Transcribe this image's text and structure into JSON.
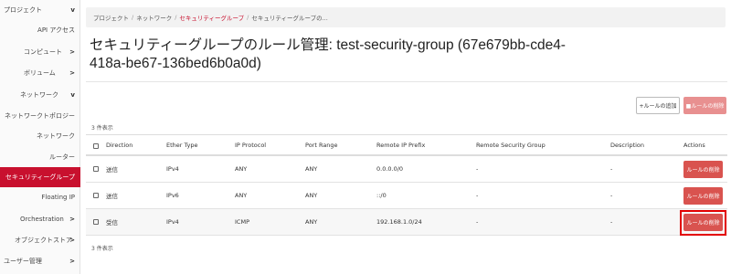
{
  "sidebar": {
    "items": [
      {
        "label": "プロジェクト",
        "chevron": "v"
      },
      {
        "label": "API アクセス",
        "chevron": ""
      },
      {
        "label": "コンピュート",
        "chevron": ">"
      },
      {
        "label": "ボリューム",
        "chevron": ">"
      },
      {
        "label": "ネットワーク",
        "chevron": "v"
      },
      {
        "label": "ネットワークトポロジー",
        "chevron": ""
      },
      {
        "label": "ネットワーク",
        "chevron": ""
      },
      {
        "label": "ルーター",
        "chevron": ""
      },
      {
        "label": "セキュリティーグループ",
        "chevron": ""
      },
      {
        "label": "Floating IP",
        "chevron": ""
      },
      {
        "label": "Orchestration",
        "chevron": ">"
      },
      {
        "label": "オブジェクトストア",
        "chevron": ">"
      },
      {
        "label": "ユーザー管理",
        "chevron": ">"
      }
    ]
  },
  "breadcrumb": {
    "items": [
      "プロジェクト",
      "ネットワーク",
      "セキュリティーグループ",
      "セキュリティーグループの..."
    ],
    "separator": "/"
  },
  "page": {
    "title": "セキュリティーグループのルール管理: test-security-group (67e679bb-cde4-418a-be67-136bed6b0a0d)"
  },
  "actions": {
    "add_rule": "+ルールの追加",
    "delete_rules": "■ルールの削除"
  },
  "table": {
    "count_top": "3 件表示",
    "count_bottom": "3 件表示",
    "headers": [
      "Direction",
      "Ether Type",
      "IP Protocol",
      "Port Range",
      "Remote IP Prefix",
      "Remote Security Group",
      "Description",
      "Actions"
    ],
    "rows": [
      {
        "direction": "送信",
        "ether_type": "IPv4",
        "ip_protocol": "ANY",
        "port_range": "ANY",
        "remote_ip_prefix": "0.0.0.0/0",
        "remote_security_group": "-",
        "description": "-",
        "action": "ルールの削除"
      },
      {
        "direction": "送信",
        "ether_type": "IPv6",
        "ip_protocol": "ANY",
        "port_range": "ANY",
        "remote_ip_prefix": "::/0",
        "remote_security_group": "-",
        "description": "-",
        "action": "ルールの削除"
      },
      {
        "direction": "受信",
        "ether_type": "IPv4",
        "ip_protocol": "ICMP",
        "port_range": "ANY",
        "remote_ip_prefix": "192.168.1.0/24",
        "remote_security_group": "-",
        "description": "-",
        "action": "ルールの削除"
      }
    ]
  },
  "colors": {
    "accent": "#c8102e",
    "danger_button": "#d9534f",
    "highlight_box": "#e30000"
  }
}
